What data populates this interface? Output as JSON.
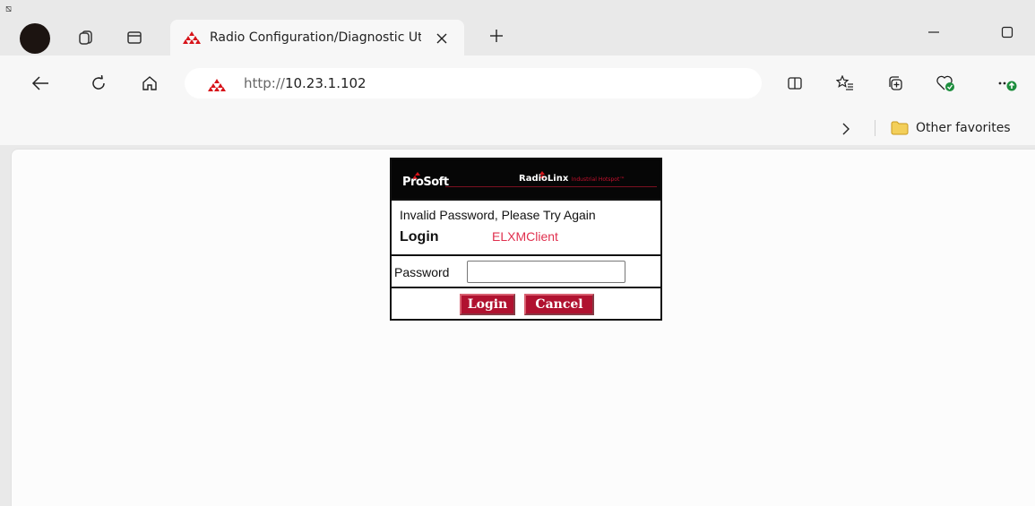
{
  "tabstrip": {
    "corner_glyph": "⧅",
    "tab": {
      "title": "Radio Configuration/Diagnostic Utility",
      "close_icon": "close-icon",
      "favicon": "prosoft-favicon"
    },
    "new_tab_icon": "plus-icon"
  },
  "toolbar": {
    "url_protocol": "http://",
    "url_host": "10.23.1.102"
  },
  "favorites": {
    "folder_label": "Other favorites"
  },
  "page": {
    "banner": {
      "prosoft_logo": "ProSoft",
      "radiolinx_logo": "RadioLinx",
      "radiolinx_tagline": "Industrial Hotspot™"
    },
    "message": "Invalid Password, Please Try Again",
    "login_label": "Login",
    "client_name": "ELXMClient",
    "password_label": "Password",
    "password_value": "",
    "login_button": "Login",
    "cancel_button": "Cancel"
  },
  "colors": {
    "accent_red": "#b01230",
    "client_name": "#e0304e",
    "banner_bg": "#060606",
    "favicon_red": "#d7141a",
    "update_badge": "#1e8e3e"
  }
}
